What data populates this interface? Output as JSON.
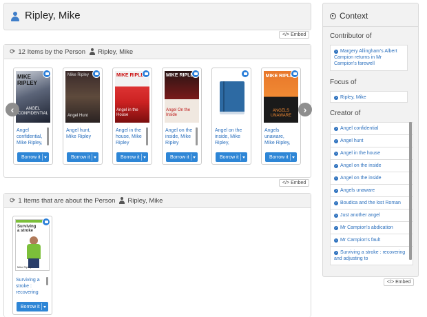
{
  "header": {
    "person_name": "Ripley, Mike",
    "embed_label": "Embed"
  },
  "by_person": {
    "heading": "12 Items by the Person",
    "person": "Ripley, Mike",
    "embed_label": "Embed",
    "items": [
      {
        "title": "Angel confidential, Mike Ripley,",
        "borrow": "Borrow it",
        "cover": "angel-confidential"
      },
      {
        "title": "Angel hunt, Mike Ripley",
        "borrow": "Borrow it",
        "cover": "angel-hunt"
      },
      {
        "title": "Angel in the house, Mike Ripley",
        "borrow": "Borrow it",
        "cover": "angel-house"
      },
      {
        "title": "Angel on the inside, Mike Ripley",
        "borrow": "Borrow it",
        "cover": "angel-inside"
      },
      {
        "title": "Angel on the inside, Mike Ripley,",
        "borrow": "Borrow it",
        "cover": "generic-book"
      },
      {
        "title": "Angels unaware, Mike Ripley,",
        "borrow": "Borrow it",
        "cover": "angels-unaware"
      }
    ],
    "cover_text": {
      "c1": {
        "author": "MIKE RIPLEY",
        "title": "ANGEL CONFIDENTIAL"
      },
      "c2": {
        "author": "Mike Ripley",
        "title": "Angel Hunt"
      },
      "c3": {
        "author": "MIKE RIPLEY",
        "title": "Angel in the House"
      },
      "c4": {
        "author": "MIKE RIPLEY",
        "title": "Angel On the Inside"
      },
      "c6": {
        "author": "MIKE RIPLEY",
        "title": "ANGELS UNAWARE"
      }
    }
  },
  "about_person": {
    "heading": "1 Items that are about the Person",
    "person": "Ripley, Mike",
    "items": [
      {
        "title": "Surviving a stroke : recovering and",
        "borrow": "Borrow it",
        "cover_title": "Surviving a stroke",
        "cover_author": "Mike Ripley"
      }
    ]
  },
  "context": {
    "title": "Context",
    "embed_label": "Embed",
    "contributor_heading": "Contributor of",
    "contributor_item": "Margery Allingham's Albert Campion returns in Mr Campion's farewell",
    "focus_heading": "Focus of",
    "focus_item": "Ripley, Mike",
    "creator_heading": "Creator of",
    "creator_items": [
      "Angel confidential",
      "Angel hunt",
      "Angel in the house",
      "Angel on the inside",
      "Angel on the inside",
      "Angels unaware",
      "Boudica and the lost Roman",
      "Just another angel",
      "Mr Campion's abdication",
      "Mr Campion's fault",
      "Surviving a stroke : recovering and adjusting to"
    ]
  }
}
